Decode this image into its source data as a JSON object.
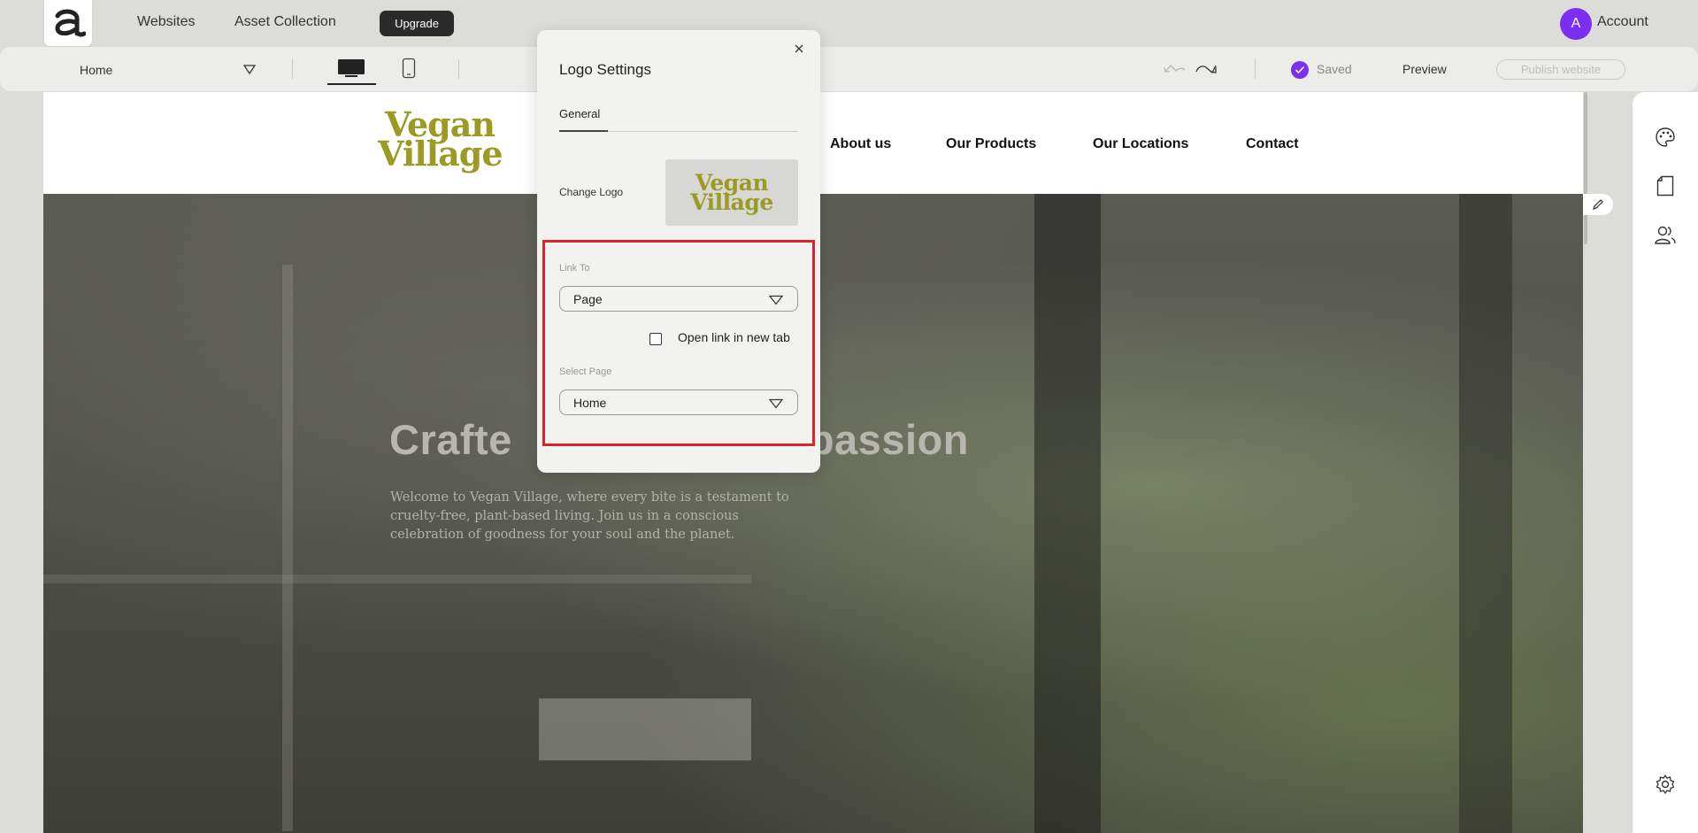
{
  "topbar": {
    "nav": [
      "Websites",
      "Asset Collection"
    ],
    "upgrade_label": "Upgrade",
    "account_initial": "A",
    "account_label": "Account"
  },
  "toolbar": {
    "page_selected": "Home",
    "saved_label": "Saved",
    "preview_label": "Preview",
    "publish_label": "Publish website"
  },
  "site": {
    "logo_line1": "Vegan",
    "logo_line2": "Village",
    "nav": [
      "About us",
      "Our Products",
      "Our Locations",
      "Contact"
    ],
    "hero_title_left": "Crafte",
    "hero_title_right": "passion",
    "hero_body": "Welcome to Vegan Village, where every bite is a testament to cruelty-free, plant-based living. Join us in a conscious celebration of goodness for your soul and the planet."
  },
  "panel": {
    "title": "Logo Settings",
    "tab": "General",
    "change_logo_label": "Change Logo",
    "link_to_label": "Link To",
    "link_to_value": "Page",
    "open_new_tab_label": "Open link in new tab",
    "open_new_tab_checked": false,
    "select_page_label": "Select Page",
    "select_page_value": "Home"
  },
  "colors": {
    "accent": "#7b2ff0",
    "logo_olive": "#9b9a22",
    "highlight_red": "#d9232e"
  },
  "icons": {
    "rail": [
      "palette-icon",
      "page-icon",
      "users-icon",
      "settings-icon"
    ]
  }
}
